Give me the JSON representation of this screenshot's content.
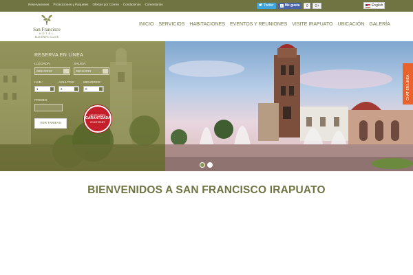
{
  "topbar": {
    "links": [
      "Reservaciones",
      "Promociones y Paquetes",
      "Ofertas por Correo",
      "Contáctenos",
      "Comentarios"
    ],
    "twitter_label": "Twitter",
    "like_label": "Me gusta",
    "like_count": "0",
    "gplus_label": "G+",
    "language": "English"
  },
  "logo": {
    "name": "San Francisco",
    "hotel": "HOTEL",
    "tagline": "BUSSINES CLASS"
  },
  "nav": {
    "items": [
      "INICIO",
      "SERVICIOS",
      "HABITACIONES",
      "EVENTOS Y REUNIONES",
      "VISITE IRAPUATO",
      "UBICACIÓN",
      "GALERÍA"
    ]
  },
  "reservation": {
    "title": "RESERVA EN LÍNEA",
    "arrival_label": "LLEGADA:",
    "arrival_value": "08/11/2013",
    "departure_label": "SALIDA:",
    "departure_value": "09/11/2013",
    "rooms_label": "HAB.:",
    "rooms_value": "1",
    "adults_label": "ADULTOS:",
    "adults_value": "2",
    "minors_label": "MENORES:",
    "minors_value": "0",
    "promo_label": "PROMO:",
    "promo_value": "",
    "submit_label": "VER TARIFAS"
  },
  "badge": {
    "top": "MEJOR TARIFA",
    "main": "GARANTIZADA",
    "bottom": "EN INTERNET"
  },
  "chat_label": "CHAT EN LÍNEA",
  "slider": {
    "current": 2,
    "total": 2
  },
  "welcome_title": "BIENVENIDOS A SAN FRANCISCO IRAPUATO",
  "colors": {
    "brand_olive": "#6f7442",
    "chat_orange": "#e8632b",
    "badge_red": "#c41f2a",
    "twitter_blue": "#3fa6dd",
    "facebook_blue": "#4a66a8"
  }
}
